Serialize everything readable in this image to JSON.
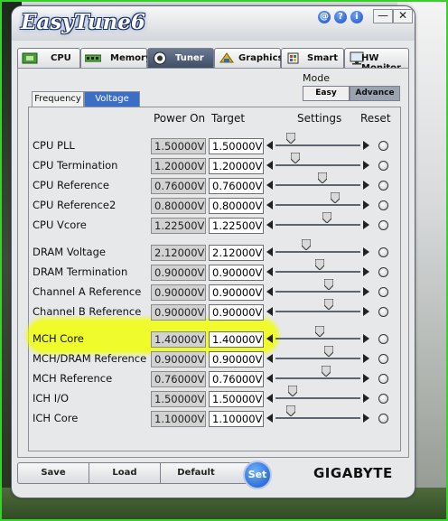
{
  "app": {
    "title": "EasyTune6",
    "title_buttons": [
      "@",
      "?",
      "i"
    ],
    "window_buttons": {
      "minimize": "—",
      "close": "✕"
    },
    "brand": "GIGABYTE"
  },
  "tabs": [
    {
      "label": "CPU",
      "icon": "cpu-icon",
      "active": false
    },
    {
      "label": "Memory",
      "icon": "memory-icon",
      "active": false
    },
    {
      "label": "Tuner",
      "icon": "tuner-icon",
      "active": true
    },
    {
      "label": "Graphics",
      "icon": "graphics-icon",
      "active": false
    },
    {
      "label": "Smart",
      "icon": "smart-icon",
      "active": false
    },
    {
      "label": "HW Monitor",
      "icon": "hw-monitor-icon",
      "active": false
    }
  ],
  "mode": {
    "label": "Mode",
    "options": [
      "Easy",
      "Advance"
    ],
    "selected": "Advance"
  },
  "subtabs": [
    {
      "label": "Frequency",
      "active": false
    },
    {
      "label": "Voltage",
      "active": true
    }
  ],
  "columns": {
    "power_on": "Power On",
    "target": "Target",
    "settings": "Settings",
    "reset": "Reset"
  },
  "rows": [
    {
      "label": "CPU PLL",
      "power_on": "1.50000V",
      "target": "1.50000V",
      "slider": 0.18
    },
    {
      "label": "CPU Termination",
      "power_on": "1.20000V",
      "target": "1.20000V",
      "slider": 0.23
    },
    {
      "label": "CPU Reference",
      "power_on": "0.76000V",
      "target": "0.76000V",
      "slider": 0.55
    },
    {
      "label": "CPU Reference2",
      "power_on": "0.80000V",
      "target": "0.80000V",
      "slider": 0.7
    },
    {
      "label": "CPU Vcore",
      "power_on": "1.22500V",
      "target": "1.22500V",
      "slider": 0.61
    },
    {
      "label": "DRAM Voltage",
      "power_on": "2.12000V",
      "target": "2.12000V",
      "slider": 0.36
    },
    {
      "label": "DRAM Termination",
      "power_on": "0.90000V",
      "target": "0.90000V",
      "slider": 0.52
    },
    {
      "label": "Channel A Reference",
      "power_on": "0.90000V",
      "target": "0.90000V",
      "slider": 0.63
    },
    {
      "label": "Channel B Reference",
      "power_on": "0.90000V",
      "target": "0.90000V",
      "slider": 0.63
    },
    {
      "label": "MCH Core",
      "power_on": "1.40000V",
      "target": "1.40000V",
      "slider": 0.52
    },
    {
      "label": "MCH/DRAM Reference",
      "power_on": "0.90000V",
      "target": "0.90000V",
      "slider": 0.63
    },
    {
      "label": "MCH Reference",
      "power_on": "0.76000V",
      "target": "0.76000V",
      "slider": 0.6
    },
    {
      "label": "ICH I/O",
      "power_on": "1.50000V",
      "target": "1.50000V",
      "slider": 0.2
    },
    {
      "label": "ICH Core",
      "power_on": "1.10000V",
      "target": "1.10000V",
      "slider": 0.18
    }
  ],
  "bottom_buttons": [
    "Save",
    "Load",
    "Default"
  ],
  "set_button": "Set"
}
